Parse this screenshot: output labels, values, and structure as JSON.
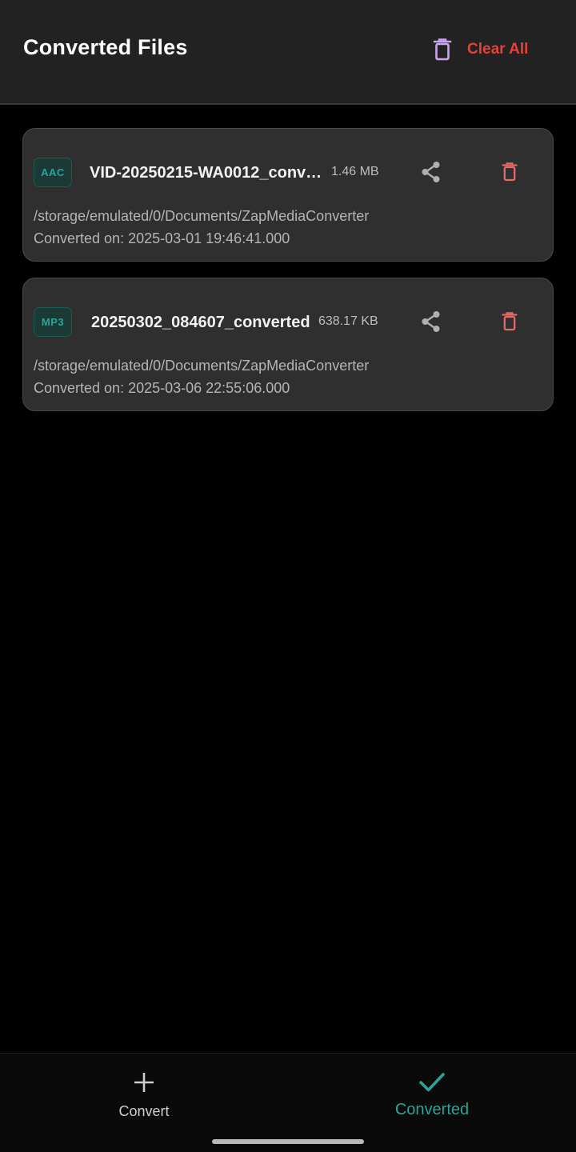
{
  "header": {
    "title": "Converted Files",
    "clear_all_label": "Clear All",
    "clear_all_icon": "trash-icon",
    "clear_icon_color": "#c9a8f0",
    "clear_label_color": "#e8413a"
  },
  "files": [
    {
      "format": "AAC",
      "name": "VID-20250215-WA0012_converted",
      "size": "1.46 MB",
      "path": "/storage/emulated/0/Documents/ZapMediaConverter",
      "date": "Converted on: 2025-03-01 19:46:41.000"
    },
    {
      "format": "MP3",
      "name": "20250302_084607_converted",
      "size": "638.17 KB",
      "path": "/storage/emulated/0/Documents/ZapMediaConverter",
      "date": "Converted on: 2025-03-06 22:55:06.000"
    }
  ],
  "nav": {
    "convert_label": "Convert",
    "converted_label": "Converted",
    "convert_icon": "plus-icon",
    "converted_icon": "check-icon",
    "active_color": "#2aa497",
    "inactive_color": "#cfcfcf"
  },
  "colors": {
    "badge_text": "#26a69a",
    "share_icon": "#b0b0b0",
    "delete_icon": "#e46a65"
  }
}
